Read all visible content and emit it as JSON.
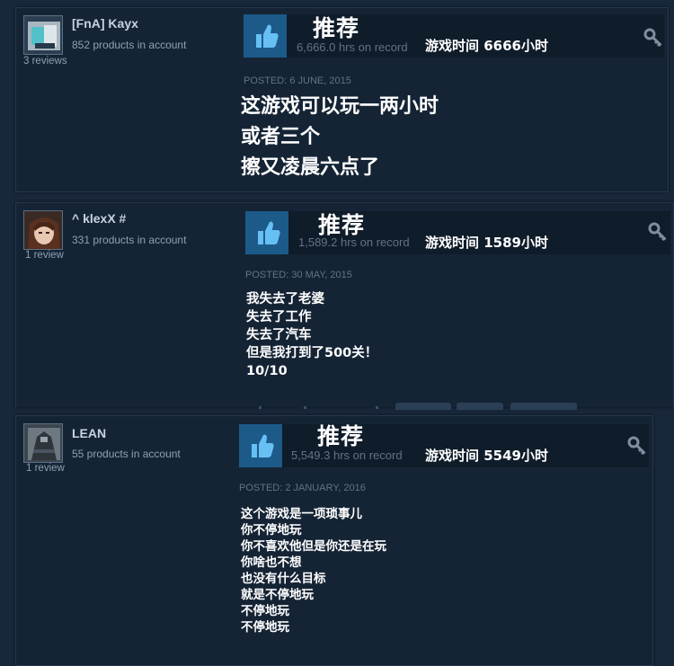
{
  "reviews": [
    {
      "author": "[FnA] Kayx",
      "products": "852 products in account",
      "review_count": "3 reviews",
      "recommendation": "推荐",
      "hours": "6,666.0 hrs on record",
      "hours_cn": "游戏时间 6666小时",
      "posted": "POSTED: 6 JUNE, 2015",
      "body": [
        "这游戏可以玩一两小时",
        "或者三个",
        "擦又凌晨六点了"
      ]
    },
    {
      "author": "^ klexX #",
      "products": "331 products in account",
      "review_count": "1 review",
      "recommendation": "推荐",
      "hours": "1,589.2 hrs on record",
      "hours_cn": "游戏时间 1589小时",
      "posted": "POSTED: 30 MAY, 2015",
      "body": [
        "我失去了老婆",
        "失去了工作",
        "失去了汽车",
        "但是我打到了500关！",
        "10/10"
      ]
    },
    {
      "author": "LEAN",
      "products": "55 products in account",
      "review_count": "1 review",
      "recommendation": "推荐",
      "hours": "5,549.3 hrs on record",
      "hours_cn": "游戏时间 5549小时",
      "posted": "POSTED: 2 JANUARY, 2016",
      "body": [
        "这个游戏是一项琐事儿",
        "你不停地玩",
        "你不喜欢他但是你还是在玩",
        "你啥也不想",
        "也没有什么目标",
        "就是不停地玩",
        "不停地玩",
        "不停地玩"
      ]
    }
  ],
  "icons": {
    "thumb": "thumbs-up-icon",
    "key": "key-icon"
  },
  "colors": {
    "page_bg": "#18273a",
    "card_bg": "#152435",
    "thumb_bg": "#1c5a8a",
    "thumb_fg": "#66c0f4",
    "muted_text": "#627384"
  }
}
